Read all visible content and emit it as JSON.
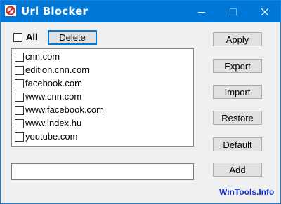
{
  "window": {
    "title": "Url Blocker"
  },
  "select_all": {
    "label": "All",
    "checked": false
  },
  "buttons": {
    "delete": "Delete",
    "apply": "Apply",
    "export": "Export",
    "import": "Import",
    "restore": "Restore",
    "default": "Default",
    "add": "Add"
  },
  "url_list": [
    {
      "label": "cnn.com",
      "checked": false
    },
    {
      "label": "edition.cnn.com",
      "checked": false
    },
    {
      "label": "facebook.com",
      "checked": false
    },
    {
      "label": "www.cnn.com",
      "checked": false
    },
    {
      "label": "www.facebook.com",
      "checked": false
    },
    {
      "label": "www.index.hu",
      "checked": false
    },
    {
      "label": "youtube.com",
      "checked": false
    }
  ],
  "url_input": {
    "value": ""
  },
  "footer": {
    "brand": "WinTools.Info"
  },
  "colors": {
    "titlebar": "#0078d7",
    "brand": "#1133cc",
    "focus_border": "#0078d7"
  }
}
